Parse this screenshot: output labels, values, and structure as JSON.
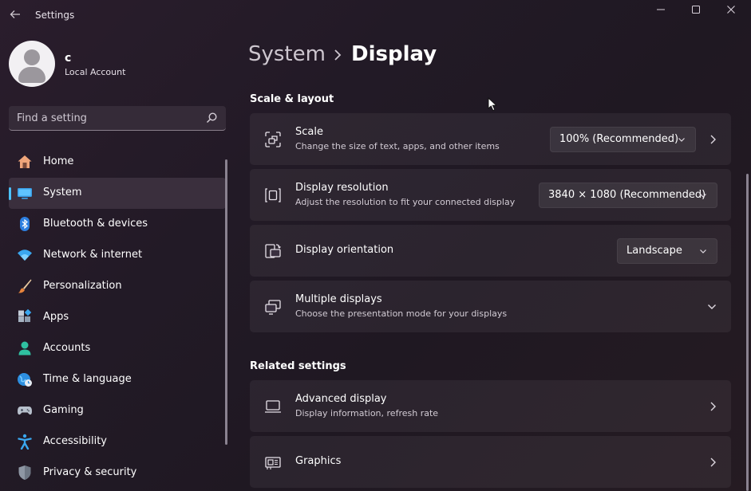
{
  "window": {
    "title": "Settings"
  },
  "profile": {
    "name": "c",
    "account_type": "Local Account"
  },
  "search": {
    "placeholder": "Find a setting"
  },
  "sidebar": {
    "items": [
      {
        "label": "Home",
        "icon": "home-icon"
      },
      {
        "label": "System",
        "icon": "system-icon",
        "active": true
      },
      {
        "label": "Bluetooth & devices",
        "icon": "bluetooth-icon"
      },
      {
        "label": "Network & internet",
        "icon": "network-icon"
      },
      {
        "label": "Personalization",
        "icon": "personalization-icon"
      },
      {
        "label": "Apps",
        "icon": "apps-icon"
      },
      {
        "label": "Accounts",
        "icon": "accounts-icon"
      },
      {
        "label": "Time & language",
        "icon": "time-language-icon"
      },
      {
        "label": "Gaming",
        "icon": "gaming-icon"
      },
      {
        "label": "Accessibility",
        "icon": "accessibility-icon"
      },
      {
        "label": "Privacy & security",
        "icon": "privacy-security-icon"
      }
    ]
  },
  "breadcrumb": {
    "parent": "System",
    "current": "Display"
  },
  "sections": {
    "scale_layout": "Scale & layout",
    "related": "Related settings"
  },
  "cards": {
    "scale": {
      "title": "Scale",
      "subtitle": "Change the size of text, apps, and other items",
      "value": "100% (Recommended)"
    },
    "resolution": {
      "title": "Display resolution",
      "subtitle": "Adjust the resolution to fit your connected display",
      "value": "3840 × 1080 (Recommended)"
    },
    "orientation": {
      "title": "Display orientation",
      "value": "Landscape"
    },
    "multiple": {
      "title": "Multiple displays",
      "subtitle": "Choose the presentation mode for your displays"
    },
    "advanced": {
      "title": "Advanced display",
      "subtitle": "Display information, refresh rate"
    },
    "graphics": {
      "title": "Graphics"
    }
  },
  "colors": {
    "accent": "#4cc2ff",
    "background": "#231a26",
    "card": "#2e2530"
  }
}
